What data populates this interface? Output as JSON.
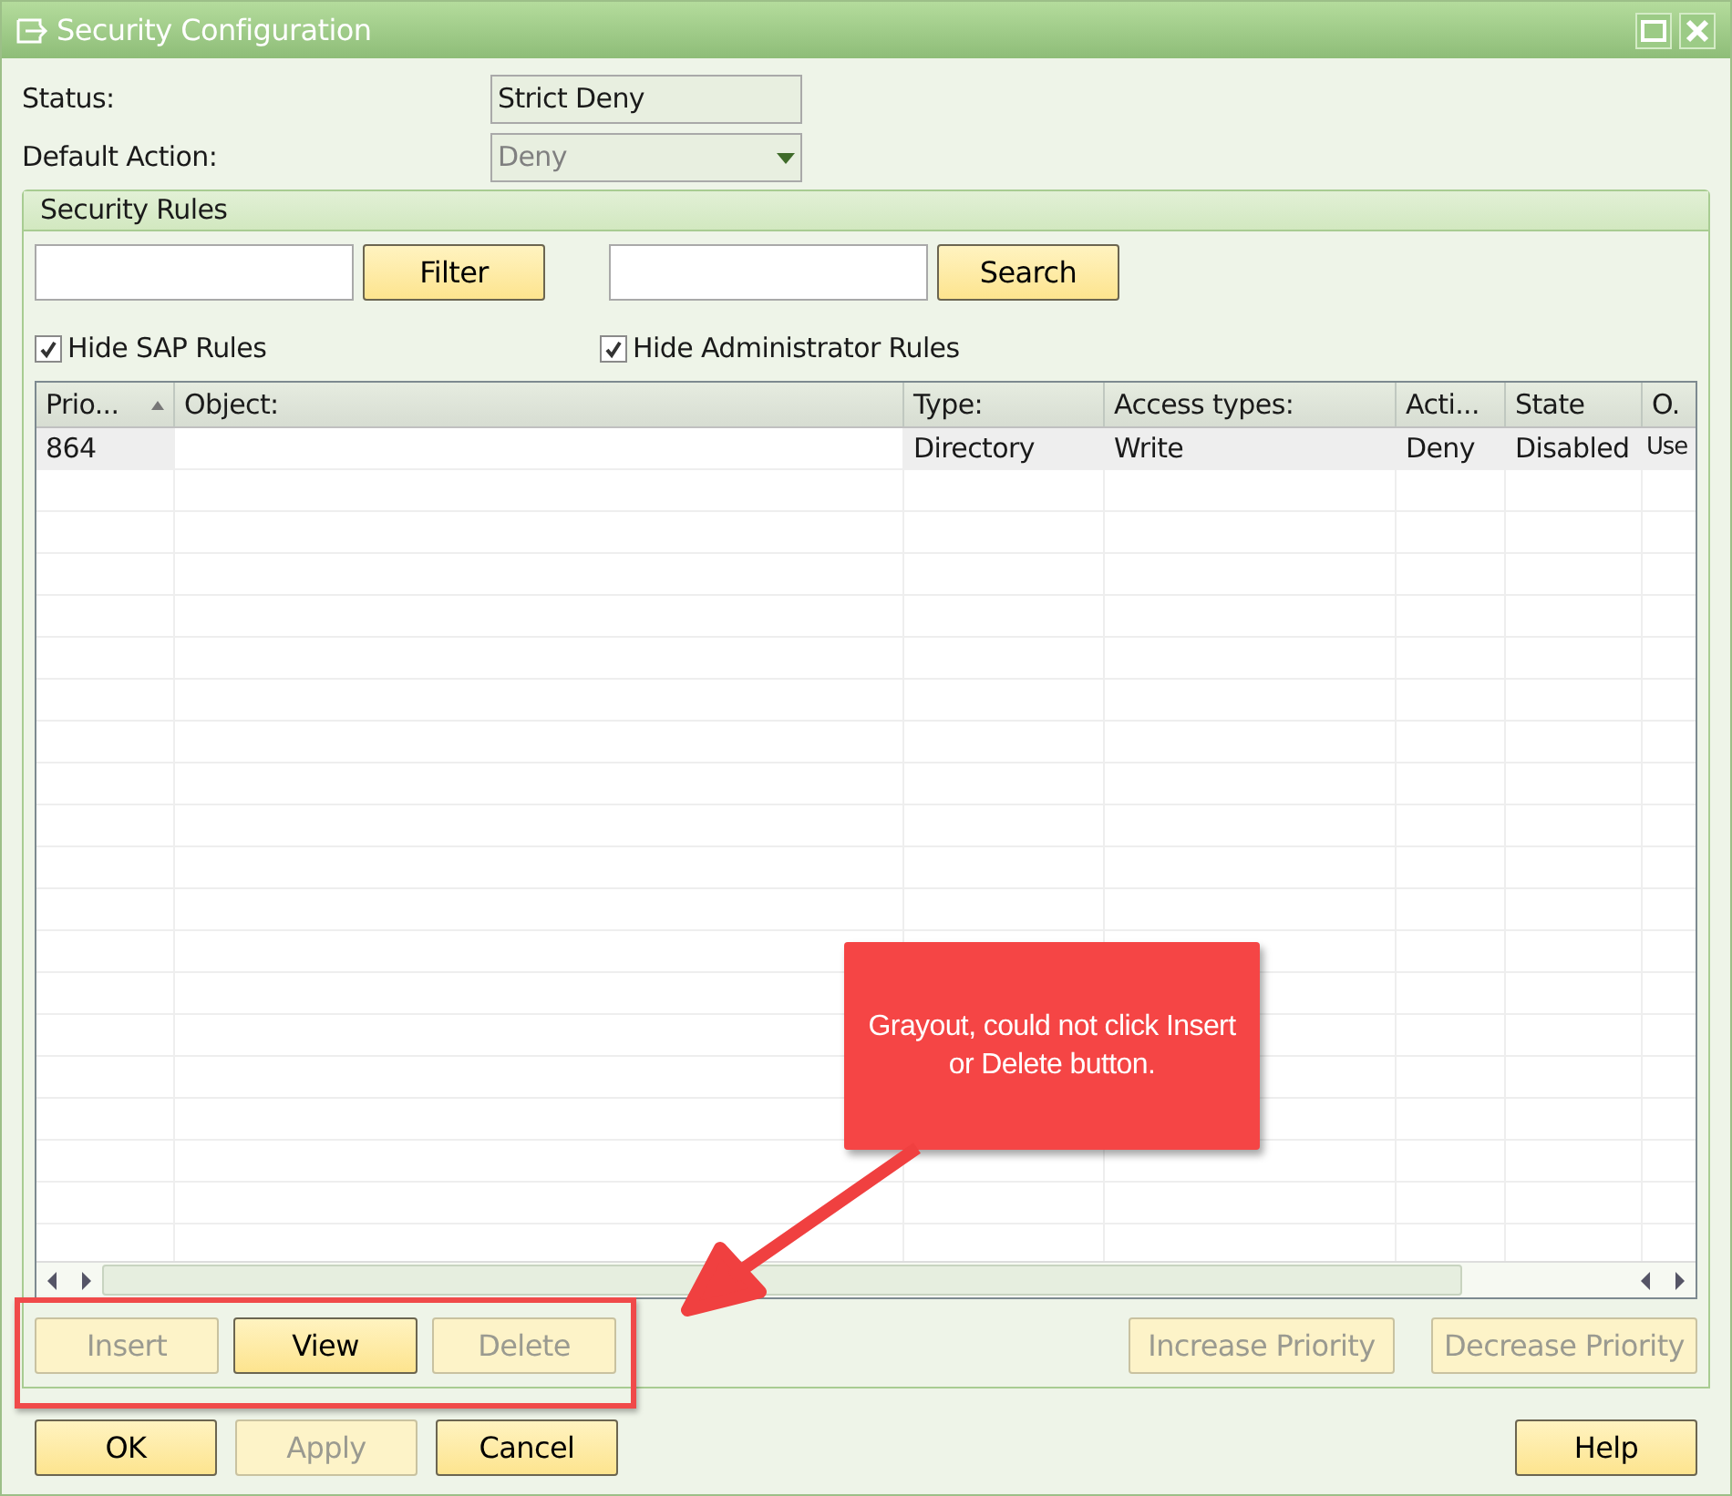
{
  "window": {
    "title": "Security Configuration"
  },
  "status": {
    "label": "Status:",
    "value": "Strict Deny"
  },
  "default_action": {
    "label": "Default Action:",
    "value": "Deny",
    "disabled": true
  },
  "group": {
    "title": "Security Rules",
    "filter": {
      "button": "Filter"
    },
    "search": {
      "button": "Search"
    },
    "checkboxes": [
      {
        "label": "Hide SAP Rules",
        "checked": true
      },
      {
        "label": "Hide Administrator Rules",
        "checked": true
      }
    ],
    "table": {
      "columns": [
        {
          "label": "Prio...",
          "sorted": true
        },
        {
          "label": "Object:",
          "sorted": false
        },
        {
          "label": "Type:",
          "sorted": false
        },
        {
          "label": "Access types:",
          "sorted": false
        },
        {
          "label": "Acti...",
          "sorted": false
        },
        {
          "label": "State",
          "sorted": false
        },
        {
          "label": "O.",
          "sorted": false
        }
      ],
      "rows": [
        {
          "selected": true,
          "cells": [
            "864",
            "",
            "Directory",
            "Write",
            "Deny",
            "Disabled",
            "Use"
          ]
        }
      ]
    },
    "row_buttons": [
      {
        "label": "Insert",
        "disabled": true
      },
      {
        "label": "View",
        "disabled": false
      },
      {
        "label": "Delete",
        "disabled": true
      }
    ],
    "priority_buttons": [
      {
        "label": "Increase Priority",
        "disabled": true
      },
      {
        "label": "Decrease Priority",
        "disabled": true
      }
    ]
  },
  "footer_buttons": [
    {
      "label": "OK",
      "disabled": false
    },
    {
      "label": "Apply",
      "disabled": true
    },
    {
      "label": "Cancel",
      "disabled": false
    }
  ],
  "help_button": {
    "label": "Help",
    "disabled": false
  },
  "annotation": {
    "text": "Grayout, could not click Insert or Delete button."
  }
}
